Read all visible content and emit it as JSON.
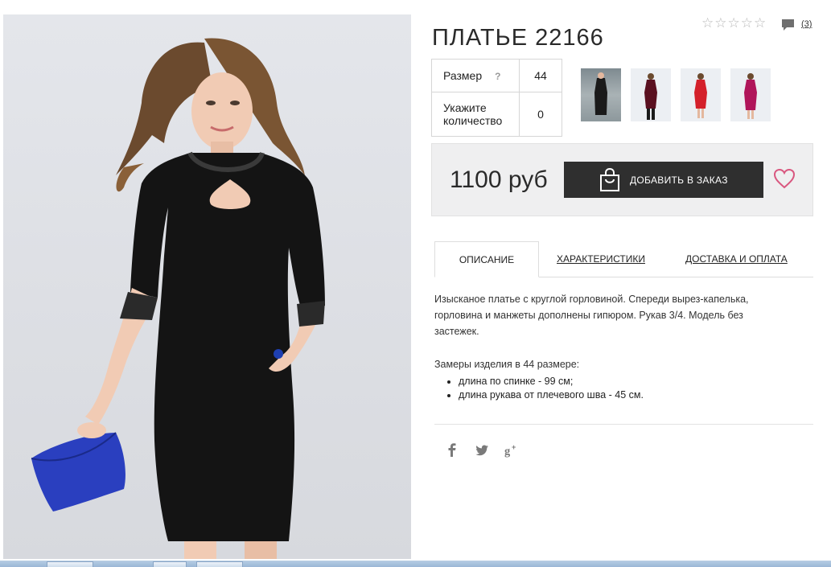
{
  "product": {
    "title": "ПЛАТЬЕ 22166",
    "rating_stars": 0,
    "rating_max": 5,
    "comments_count": "(3)"
  },
  "options": {
    "size_label": "Размер",
    "size_help": "?",
    "size_value": "44",
    "qty_label": "Укажите количество",
    "qty_value": "0"
  },
  "buy": {
    "price": "1100 руб",
    "add_button": "ДОБАВИТЬ В ЗАКАЗ"
  },
  "tabs": [
    {
      "label": "ОПИСАНИЕ",
      "active": true
    },
    {
      "label": "ХАРАКТЕРИСТИКИ",
      "active": false
    },
    {
      "label": "ДОСТАВКА И ОПЛАТА",
      "active": false
    }
  ],
  "description": {
    "text": "Изысканое платье с круглой горловиной. Спереди вырез-капелька, горловина и манжеты дополнены гипюром. Рукав 3/4. Модель без застежек.",
    "measures_title": "Замеры изделия в 44 размере:",
    "measures": [
      "длина по спинке - 99 см;",
      "длина рукава от плечевого шва - 45 см."
    ]
  },
  "thumbnails": [
    {
      "name": "thumbnail-black",
      "dress_color": "#1a1a1a"
    },
    {
      "name": "thumbnail-burgundy",
      "dress_color": "#5a1020"
    },
    {
      "name": "thumbnail-red",
      "dress_color": "#d4202a"
    },
    {
      "name": "thumbnail-magenta",
      "dress_color": "#b0155a"
    }
  ],
  "social": [
    "facebook-icon",
    "twitter-icon",
    "google-plus-icon"
  ],
  "colors": {
    "button_bg": "#2f2f2f",
    "heart": "#d9577f",
    "buybox_bg": "#efeff0",
    "star": "#b9b9b9"
  }
}
